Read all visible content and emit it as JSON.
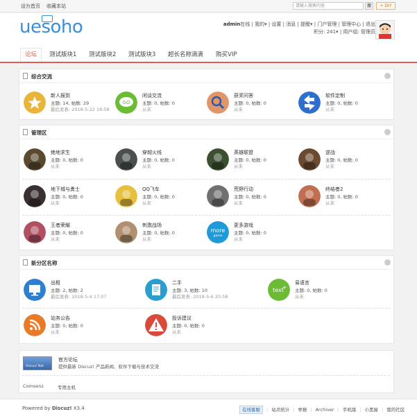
{
  "topbar": {
    "set_home": "设为首页",
    "favorite": "收藏本站",
    "search_placeholder": "请输入搜索内容",
    "search_btn": "搜",
    "diy": "+ DIY"
  },
  "header": {
    "logo": "uesoho",
    "user": "admin",
    "online": "在线",
    "mine": "我的",
    "settings": "设置",
    "messages": "消息",
    "reminders": "提醒",
    "portal_admin": "门户管理",
    "admin_center": "管理中心",
    "logout": "退出",
    "points": "积分: 241",
    "usergroup": "用户组: 管理员"
  },
  "nav": [
    "论坛",
    "测试版块1",
    "测试版块2",
    "测试版块3",
    "超长名称滴滴",
    "购买VIP"
  ],
  "groups": [
    {
      "title": "综合交流",
      "forums": [
        {
          "name": "新人报到",
          "stats": "主题: 14, 帖数: 29",
          "last": "最后发表: 2018-5-22 18:58",
          "icon": "star-icon",
          "color": "#e8b43a"
        },
        {
          "name": "闲谈交流",
          "stats": "主题: 0, 帖数: 0",
          "last": "从未",
          "icon": "chat-icon",
          "color": "#6bbb35"
        },
        {
          "name": "获奖问答",
          "stats": "主题: 0, 帖数: 0",
          "last": "从未",
          "icon": "magnifier-icon",
          "color": "#e0956a"
        },
        {
          "name": "软件定制",
          "stats": "主题: 0, 帖数: 0",
          "last": "从未",
          "icon": "arrows-icon",
          "color": "#2d6fcc"
        }
      ]
    },
    {
      "title": "管理区",
      "forums": [
        {
          "name": "绝地求生",
          "stats": "主题: 0, 帖数: 0",
          "last": "从未",
          "icon": "game-avatar-icon",
          "color": "#5a4a30"
        },
        {
          "name": "穿越火线",
          "stats": "主题: 0, 帖数: 0",
          "last": "从未",
          "icon": "game-avatar-icon",
          "color": "#4a5050"
        },
        {
          "name": "英雄联盟",
          "stats": "主题: 0, 帖数: 0",
          "last": "从未",
          "icon": "game-avatar-icon",
          "color": "#3a5030"
        },
        {
          "name": "逆战",
          "stats": "主题: 0, 帖数: 0",
          "last": "从未",
          "icon": "game-avatar-icon",
          "color": "#6a4a30"
        },
        {
          "name": "地下城与勇士",
          "stats": "主题: 0, 帖数: 0",
          "last": "从未",
          "icon": "game-avatar-icon",
          "color": "#3a3030"
        },
        {
          "name": "QQ飞车",
          "stats": "主题: 0, 帖数: 0",
          "last": "从未",
          "icon": "game-avatar-icon",
          "color": "#e8c040"
        },
        {
          "name": "荒野行动",
          "stats": "主题: 0, 帖数: 0",
          "last": "从未",
          "icon": "game-avatar-icon",
          "color": "#707070"
        },
        {
          "name": "终结者2",
          "stats": "主题: 0, 帖数: 0",
          "last": "从未",
          "icon": "game-avatar-icon",
          "color": "#c07050"
        },
        {
          "name": "王者荣耀",
          "stats": "主题: 0, 帖数: 0",
          "last": "从未",
          "icon": "game-avatar-icon",
          "color": "#b05060"
        },
        {
          "name": "刺激战场",
          "stats": "主题: 0, 帖数: 0",
          "last": "从未",
          "icon": "game-avatar-icon",
          "color": "#b09070"
        },
        {
          "name": "更多游戏",
          "stats": "主题: 0, 帖数: 0",
          "last": "从未",
          "icon": "more-game-icon",
          "color": "#1e9ad8"
        }
      ]
    },
    {
      "title": "新分区名称",
      "forums": [
        {
          "name": "出租",
          "stats": "主题: 2, 帖数: 2",
          "last": "最后发表: 2018-5-4 17:07",
          "icon": "monitor-icon",
          "color": "#2d7fd0"
        },
        {
          "name": "二手",
          "stats": "主题: 3, 帖数: 10",
          "last": "最后发表: 2018-5-6 20:58",
          "icon": "document-icon",
          "color": "#2a9fcf"
        },
        {
          "name": "易语言",
          "stats": "主题: 0, 帖数: 0",
          "last": "从未",
          "icon": "text-plus-icon",
          "color": "#6bbb35"
        },
        {
          "name": "站务公告",
          "stats": "主题: 0, 帖数: 0",
          "last": "从未",
          "icon": "rss-icon",
          "color": "#e87a28"
        },
        {
          "name": "投诉建议",
          "stats": "主题: 0, 帖数: 0",
          "last": "从未",
          "icon": "warning-icon",
          "color": "#d94a3a"
        }
      ]
    }
  ],
  "friend": {
    "logo_text": "Discuz! Net",
    "title": "官方论坛",
    "desc": "提供最新 Discuz! 产品新闻、软件下载与技术交流",
    "link1": "Comsenz",
    "link2": "专用主机"
  },
  "footer": {
    "powered": "Powered by",
    "brand": "Discuz!",
    "version": "X3.4",
    "links": [
      "在线客服",
      "站点统计",
      "举报",
      "Archiver",
      "手机版",
      "小黑屋",
      "我的社区"
    ]
  }
}
